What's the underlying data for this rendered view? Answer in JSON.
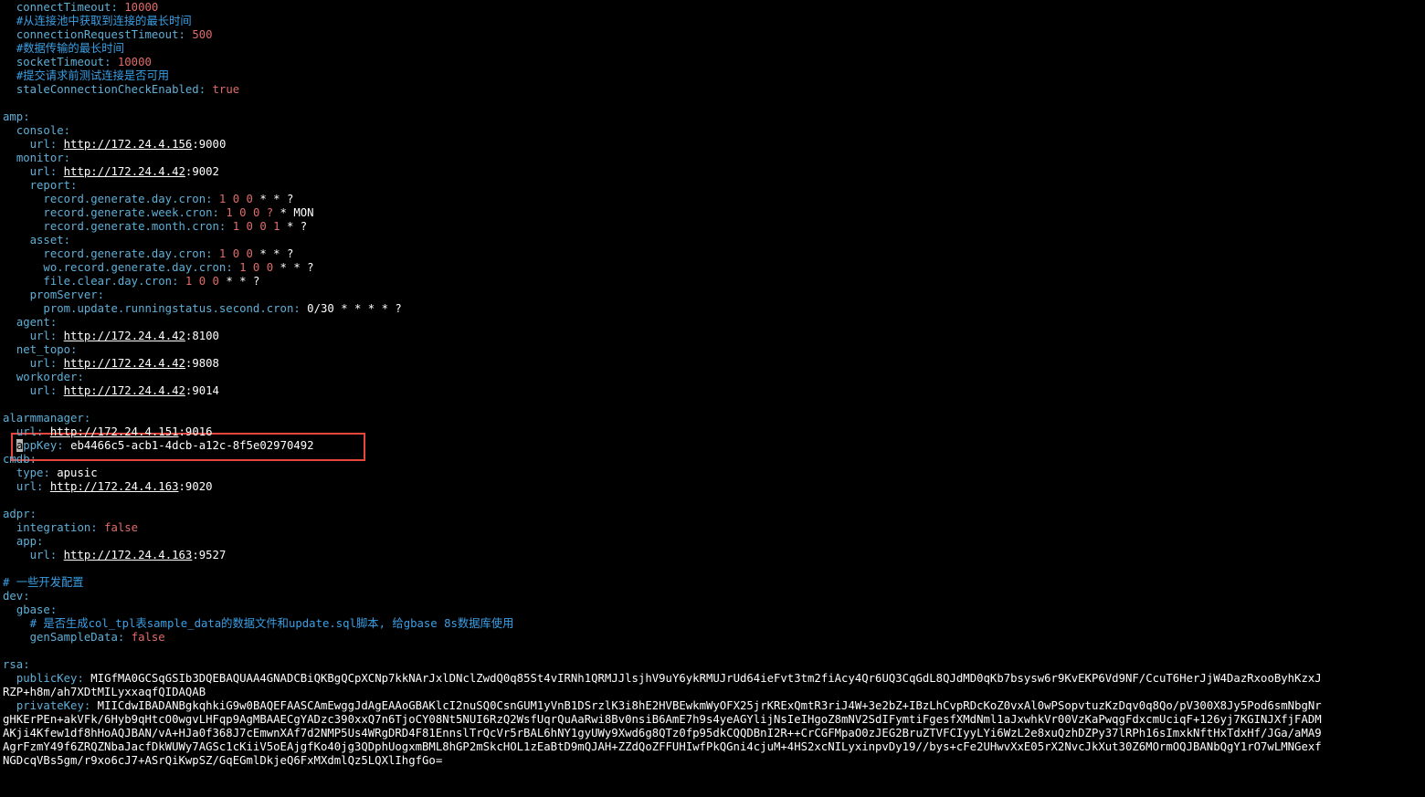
{
  "editor": {
    "colors": {
      "background": "#000000",
      "key": "#5fafd7",
      "comment": "#3aa0e6",
      "number": "#e06c6c",
      "text": "#dcdcdc",
      "highlight_box": "#e8453c"
    },
    "lines": [
      {
        "indent": "  ",
        "key": "connectTimeout",
        "sep": ": ",
        "num": "10000"
      },
      {
        "indent": "  ",
        "comment": "#从连接池中获取到连接的最长时间"
      },
      {
        "indent": "  ",
        "key": "connectionRequestTimeout",
        "sep": ": ",
        "num": "500"
      },
      {
        "indent": "  ",
        "comment": "#数据传输的最长时间"
      },
      {
        "indent": "  ",
        "key": "socketTimeout",
        "sep": ": ",
        "num": "10000"
      },
      {
        "indent": "  ",
        "comment": "#提交请求前测试连接是否可用"
      },
      {
        "indent": "  ",
        "key": "staleConnectionCheckEnabled",
        "sep": ": ",
        "num": "true"
      },
      {
        "blank": true
      },
      {
        "indent": "",
        "key": "amp",
        "sep": ":"
      },
      {
        "indent": "  ",
        "key": "console",
        "sep": ":"
      },
      {
        "indent": "    ",
        "key": "url",
        "sep": ": ",
        "url": "http://172.24.4.156",
        "rest": ":9000"
      },
      {
        "indent": "  ",
        "key": "monitor",
        "sep": ":"
      },
      {
        "indent": "    ",
        "key": "url",
        "sep": ": ",
        "url": "http://172.24.4.42",
        "rest": ":9002"
      },
      {
        "indent": "    ",
        "key": "report",
        "sep": ":"
      },
      {
        "indent": "      ",
        "key": "record.generate.day.cron",
        "sep": ": ",
        "num": "1 0 0",
        "rest": " * * ?"
      },
      {
        "indent": "      ",
        "key": "record.generate.week.cron",
        "sep": ": ",
        "num": "1 0 0 ?",
        "rest": " * MON"
      },
      {
        "indent": "      ",
        "key": "record.generate.month.cron",
        "sep": ": ",
        "num": "1 0 0 1",
        "rest": " * ?"
      },
      {
        "indent": "    ",
        "key": "asset",
        "sep": ":"
      },
      {
        "indent": "      ",
        "key": "record.generate.day.cron",
        "sep": ": ",
        "num": "1 0 0",
        "rest": " * * ?"
      },
      {
        "indent": "      ",
        "key": "wo.record.generate.day.cron",
        "sep": ": ",
        "num": "1 0 0",
        "rest": " * * ?"
      },
      {
        "indent": "      ",
        "key": "file.clear.day.cron",
        "sep": ": ",
        "num": "1 0 0",
        "rest": " * * ?"
      },
      {
        "indent": "    ",
        "key": "promServer",
        "sep": ":"
      },
      {
        "indent": "      ",
        "key": "prom.update.runningstatus.second.cron",
        "sep": ": ",
        "rest": "0/30 * * * * ?"
      },
      {
        "indent": "  ",
        "key": "agent",
        "sep": ":"
      },
      {
        "indent": "    ",
        "key": "url",
        "sep": ": ",
        "url": "http://172.24.4.42",
        "rest": ":8100"
      },
      {
        "indent": "  ",
        "key": "net_topo",
        "sep": ":"
      },
      {
        "indent": "    ",
        "key": "url",
        "sep": ": ",
        "url": "http://172.24.4.42",
        "rest": ":9808"
      },
      {
        "indent": "  ",
        "key": "workorder",
        "sep": ":"
      },
      {
        "indent": "    ",
        "key": "url",
        "sep": ": ",
        "url": "http://172.24.4.42",
        "rest": ":9014"
      },
      {
        "blank": true
      },
      {
        "indent": "",
        "key": "alarmmanager",
        "sep": ":"
      },
      {
        "indent": "  ",
        "key": "url",
        "sep": ": ",
        "url": "http://172.24.4.151",
        "rest": ":9016"
      },
      {
        "indent": "  ",
        "cursor": "a",
        "key": "ppKey",
        "sep": ": ",
        "rest": "eb4466c5-acb1-4dcb-a12c-8f5e02970492"
      },
      {
        "indent": "",
        "key": "cmdb",
        "sep": ":"
      },
      {
        "indent": "  ",
        "key": "type",
        "sep": ": ",
        "rest": "apusic"
      },
      {
        "indent": "  ",
        "key": "url",
        "sep": ": ",
        "url": "http://172.24.4.163",
        "rest": ":9020"
      },
      {
        "blank": true
      },
      {
        "indent": "",
        "key": "adpr",
        "sep": ":"
      },
      {
        "indent": "  ",
        "key": "integration",
        "sep": ": ",
        "num": "false"
      },
      {
        "indent": "  ",
        "key": "app",
        "sep": ":"
      },
      {
        "indent": "    ",
        "key": "url",
        "sep": ": ",
        "url": "http://172.24.4.163",
        "rest": ":9527"
      },
      {
        "blank": true
      },
      {
        "indent": "",
        "comment": "# 一些开发配置"
      },
      {
        "indent": "",
        "key": "dev",
        "sep": ":"
      },
      {
        "indent": "  ",
        "key": "gbase",
        "sep": ":"
      },
      {
        "indent": "    ",
        "comment": "# 是否生成col_tpl表sample_data的数据文件和update.sql脚本, 给gbase 8s数据库使用"
      },
      {
        "indent": "    ",
        "key": "genSampleData",
        "sep": ": ",
        "num": "false"
      },
      {
        "blank": true
      },
      {
        "indent": "",
        "key": "rsa",
        "sep": ":"
      },
      {
        "indent": "  ",
        "key": "publicKey",
        "sep": ": ",
        "rest": "MIGfMA0GCSqGSIb3DQEBAQUAA4GNADCBiQKBgQCpXCNp7kkNArJxlDNclZwdQ0q85St4vIRNh1QRMJJlsjhV9uY6ykRMUJrUd64ieFvt3tm2fiAcy4Qr6UQ3CqGdL8QJdMD0qKb7bsysw6r9KvEKP6Vd9NF/CcuT6HerJjW4DazRxooByhKzxJ"
      },
      {
        "indent": "",
        "rest": "RZP+h8m/ah7XDtMILyxxaqfQIDAQAB"
      },
      {
        "indent": "  ",
        "key": "privateKey",
        "sep": ": ",
        "rest": "MIICdwIBADANBgkqhkiG9w0BAQEFAASCAmEwggJdAgEAAoGBAKlcI2nuSQ0CsnGUM1yVnB1DSrzlK3i8hE2HVBEwkmWyOFX25jrKRExQmtR3riJ4W+3e2bZ+IBzLhCvpRDcKoZ0vxAl0wPSopvtuzKzDqv0q8Qo/pV300X8Jy5Pod6smNbgNr"
      },
      {
        "indent": "",
        "rest": "gHKErPEn+akVFk/6Hyb9qHtcO0wgvLHFqp9AgMBAAECgYADzc390xxQ7n6TjoCY08Nt5NUI6RzQ2WsfUqrQuAaRwi8Bv0nsiB6AmE7h9s4yeAGYlijNsIeIHgoZ8mNV2SdIFymtiFgesfXMdNml1aJxwhkVr00VzKaPwqgFdxcmUciqF+126yj7KGINJXfjFADM"
      },
      {
        "indent": "",
        "rest": "AKji4Kfew1df8hHoAQJBAN/vA+HJa0f368J7cEmwnXAf7d2NMP5Us4WRgDRD4F81EnnslTrQcVr5rBAL6hNY1gyUWy9Xwd6g8QTz0fp95dkCQQDBnI2R++CrCGFMpaO0zJEG2BruZTVFCIyyLYi6WzL2e8xuQzhDZPy37lRPh16sImxkNftHxTdxHf/JGa/aMA9"
      },
      {
        "indent": "",
        "rest": "AgrFzmY49f6ZRQZNbaJacfDkWUWy7AGSc1cKiiV5oEAjgfKo40jg3QDphUogxmBML8hGP2mSkcHOL1zEaBtD9mQJAH+ZZdQoZFFUHIwfPkQGni4cjuM+4HS2xcNILyxinpvDy19//bys+cFe2UHwvXxE05rX2NvcJkXut30Z6MOrmOQJBANbQgY1rO7wLMNGexf"
      },
      {
        "indent": "",
        "rest": "NGDcqVBs5gm/r9xo6cJ7+ASrQiKwpSZ/GqEGmlDkjeQ6FxMXdmlQz5LQXlIhgfGo="
      }
    ]
  }
}
